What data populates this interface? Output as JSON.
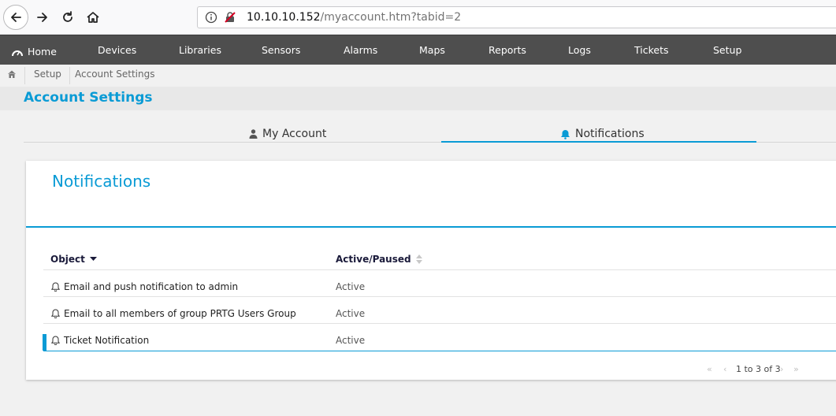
{
  "browser": {
    "url_host": "10.10.10.152",
    "url_path": "/myaccount.htm?tabid=2"
  },
  "nav": {
    "home": "Home",
    "items": [
      "Devices",
      "Libraries",
      "Sensors",
      "Alarms",
      "Maps",
      "Reports",
      "Logs",
      "Tickets",
      "Setup"
    ]
  },
  "breadcrumb": [
    "Setup",
    "Account Settings"
  ],
  "page": {
    "title": "Account Settings"
  },
  "tabs": [
    {
      "label": "My Account",
      "icon": "user-icon",
      "active": false
    },
    {
      "label": "Notifications",
      "icon": "bell-icon",
      "active": true
    }
  ],
  "card": {
    "title": "Notifications",
    "columns": [
      "Object",
      "Active/Paused"
    ],
    "rows": [
      {
        "object": "Email and push notification to admin",
        "status": "Active"
      },
      {
        "object": "Email to all members of group PRTG Users Group",
        "status": "Active"
      },
      {
        "object": "Ticket Notification",
        "status": "Active"
      }
    ],
    "pager": "1 to 3 of 3"
  },
  "colors": {
    "accent": "#0a9bd5",
    "nav_bg": "#4e4e4e"
  }
}
